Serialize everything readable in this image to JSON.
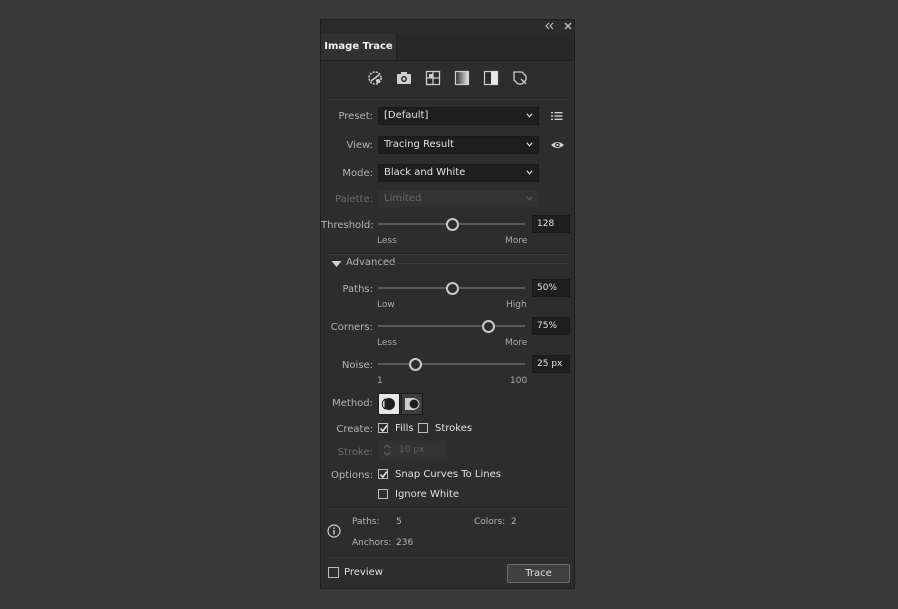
{
  "panel": {
    "tab_title": "Image Trace",
    "collapse_icon": "double-chevron-left-icon",
    "close_icon": "close-icon"
  },
  "presets_toolbar": [
    {
      "name": "auto-color-preset-icon"
    },
    {
      "name": "high-color-preset-icon"
    },
    {
      "name": "low-color-preset-icon"
    },
    {
      "name": "grayscale-preset-icon"
    },
    {
      "name": "black-and-white-preset-icon"
    },
    {
      "name": "outline-preset-icon"
    }
  ],
  "preset": {
    "label": "Preset:",
    "value": "[Default]",
    "menu_icon": "list-menu-icon"
  },
  "view": {
    "label": "View:",
    "value": "Tracing Result",
    "eye_icon": "eye-icon"
  },
  "mode": {
    "label": "Mode:",
    "value": "Black and White"
  },
  "palette": {
    "label": "Palette:",
    "value": "Limited",
    "disabled": true
  },
  "threshold": {
    "label": "Threshold:",
    "value": "128",
    "min_label": "Less",
    "max_label": "More",
    "level": 0.5
  },
  "advanced": {
    "label": "Advanced",
    "expanded": true
  },
  "paths": {
    "label": "Paths:",
    "value": "50%",
    "min_label": "Low",
    "max_label": "High",
    "level": 0.5
  },
  "corners": {
    "label": "Corners:",
    "value": "75%",
    "min_label": "Less",
    "max_label": "More",
    "level": 0.75
  },
  "noise": {
    "label": "Noise:",
    "value": "25 px",
    "min_label": "1",
    "max_label": "100",
    "level": 0.25
  },
  "method": {
    "label": "Method:",
    "options": [
      "abutting",
      "overlapping"
    ],
    "selected": "abutting"
  },
  "create": {
    "label": "Create:",
    "fills_label": "Fills",
    "fills_checked": true,
    "strokes_label": "Strokes",
    "strokes_checked": false
  },
  "stroke": {
    "label": "Stroke:",
    "value": "10 px",
    "disabled": true
  },
  "options": {
    "label": "Options:",
    "snap_label": "Snap Curves To Lines",
    "snap_checked": true,
    "ignore_white_label": "Ignore White",
    "ignore_white_checked": false
  },
  "info": {
    "paths_label": "Paths:",
    "paths_value": "5",
    "colors_label": "Colors:",
    "colors_value": "2",
    "anchors_label": "Anchors:",
    "anchors_value": "236"
  },
  "footer": {
    "preview_label": "Preview",
    "preview_checked": false,
    "trace_label": "Trace"
  },
  "colors": {
    "panel_bg": "#2d2d2d",
    "page_bg": "#3a3a3a",
    "field_bg": "#1e1e1e"
  }
}
